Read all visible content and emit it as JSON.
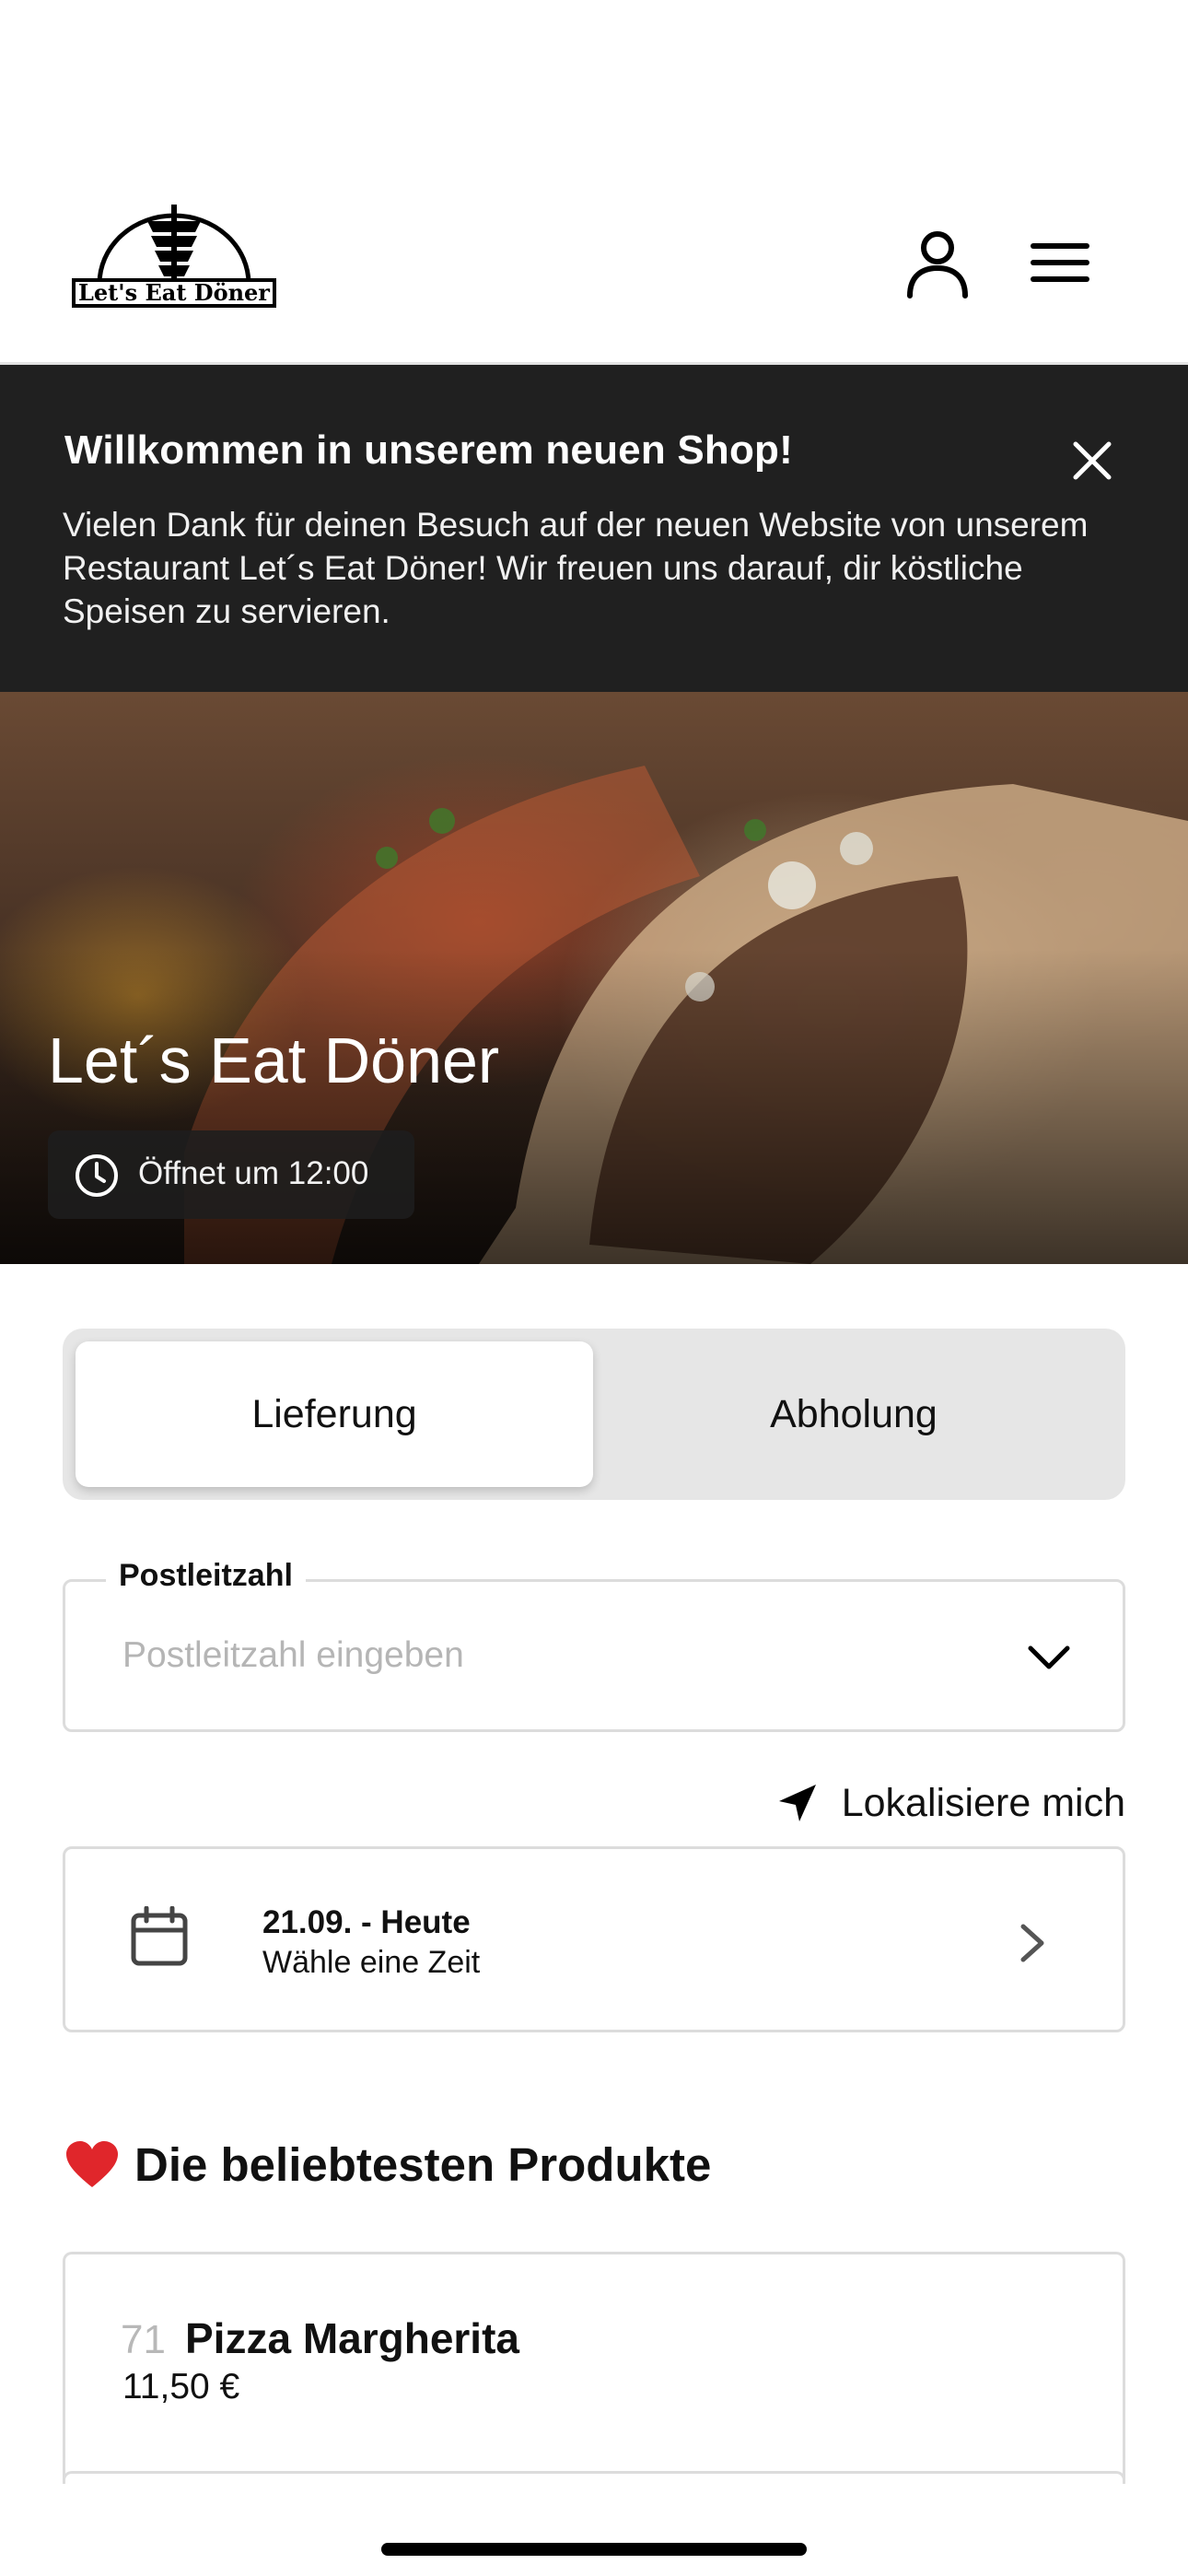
{
  "header": {
    "logo_text": "Let's Eat Döner",
    "icons": [
      "user-icon",
      "hamburger-menu-icon"
    ]
  },
  "banner": {
    "title": "Willkommen in unserem neuen Shop!",
    "text": "Vielen Dank für deinen Besuch auf der neuen Website von unserem Restaurant Let´s Eat Döner! Wir freuen uns darauf, dir köstliche Speisen zu servieren.",
    "close_icon": "close-icon"
  },
  "hero": {
    "title": "Let´s Eat Döner",
    "opening": "Öffnet um 12:00"
  },
  "order_mode": {
    "options": [
      "Lieferung",
      "Abholung"
    ],
    "selected": "Lieferung"
  },
  "postal_code": {
    "label": "Postleitzahl",
    "placeholder": "Postleitzahl eingeben",
    "value": ""
  },
  "locate": {
    "label": "Lokalisiere mich"
  },
  "time_select": {
    "date": "21.09. - Heute",
    "subtitle": "Wähle eine Zeit"
  },
  "popular": {
    "title": "Die beliebtesten Produkte",
    "products": [
      {
        "number": "71",
        "name": "Pizza Margherita",
        "price": "11,50 €"
      }
    ]
  }
}
